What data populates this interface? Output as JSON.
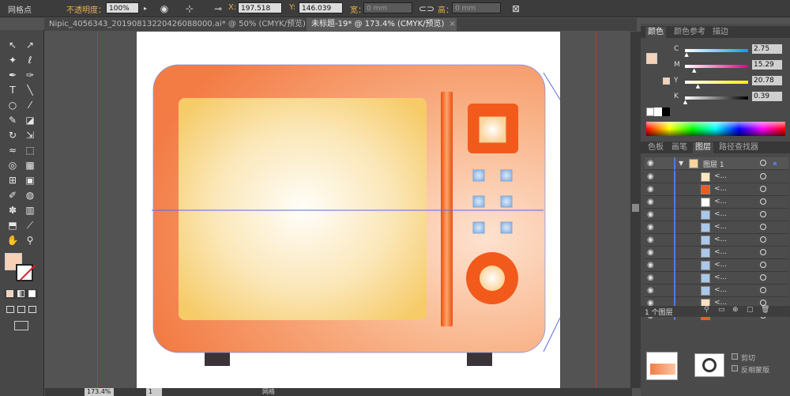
{
  "control_bar": {
    "tool_name": "网格点",
    "opacity_label": "不透明度：",
    "opacity_value": "100%",
    "x_label": "X:",
    "x_value": "197.518",
    "y_label": "Y:",
    "y_value": "146.039",
    "width_label": "宽：",
    "width_value": "0 mm",
    "height_label": "高：",
    "height_value": "0 mm"
  },
  "tabs": [
    {
      "label": "Nipic_4056343_20190813220426088000.ai* @ 50% (CMYK/预览)",
      "close": "×",
      "active": false
    },
    {
      "label": "未标题-19* @ 173.4% (CMYK/预览)",
      "close": "×",
      "active": true
    }
  ],
  "tools": [
    {
      "name": "selection-tool",
      "glyph": "↖"
    },
    {
      "name": "direct-selection-tool",
      "glyph": "↗"
    },
    {
      "name": "magic-wand-tool",
      "glyph": "✦"
    },
    {
      "name": "lasso-tool",
      "glyph": "ℓ"
    },
    {
      "name": "pen-tool",
      "glyph": "✒"
    },
    {
      "name": "curvature-tool",
      "glyph": "✑"
    },
    {
      "name": "type-tool",
      "glyph": "T"
    },
    {
      "name": "line-tool",
      "glyph": "╲"
    },
    {
      "name": "ellipse-tool",
      "glyph": "○"
    },
    {
      "name": "paintbrush-tool",
      "glyph": "⁄"
    },
    {
      "name": "pencil-tool",
      "glyph": "✎"
    },
    {
      "name": "eraser-tool",
      "glyph": "◪"
    },
    {
      "name": "rotate-tool",
      "glyph": "↻"
    },
    {
      "name": "scale-tool",
      "glyph": "⇲"
    },
    {
      "name": "warp-tool",
      "glyph": "≈"
    },
    {
      "name": "free-transform-tool",
      "glyph": "⬚"
    },
    {
      "name": "shape-builder-tool",
      "glyph": "◎"
    },
    {
      "name": "perspective-grid-tool",
      "glyph": "▦"
    },
    {
      "name": "mesh-tool",
      "glyph": "⊞"
    },
    {
      "name": "gradient-tool",
      "glyph": "▣"
    },
    {
      "name": "eyedropper-tool",
      "glyph": "✐"
    },
    {
      "name": "blend-tool",
      "glyph": "◍"
    },
    {
      "name": "symbol-sprayer-tool",
      "glyph": "✽"
    },
    {
      "name": "column-graph-tool",
      "glyph": "▥"
    },
    {
      "name": "artboard-tool",
      "glyph": "⬒"
    },
    {
      "name": "slice-tool",
      "glyph": "⟋"
    },
    {
      "name": "hand-tool",
      "glyph": "✋"
    },
    {
      "name": "zoom-tool",
      "glyph": "⚲"
    }
  ],
  "colors": {
    "fill_swatch": "#f7d1b5",
    "microwave_body_light": "#fbc6a4",
    "microwave_body_dark": "#f3844f",
    "accent": "#f25a1c",
    "window_center": "#fffdf8",
    "window_edge": "#f7cc69",
    "button_blue": "#9fc3e8",
    "feet": "#3a3338"
  },
  "color_panel": {
    "tabs": [
      "颜色",
      "颜色参考",
      "描边"
    ],
    "channels": [
      {
        "key": "C",
        "value": "2.75",
        "gradient": "linear-gradient(90deg,#fff,#00a0e6)",
        "pos": 0.03
      },
      {
        "key": "M",
        "value": "15.29",
        "gradient": "linear-gradient(90deg,#fff,#e6007e)",
        "pos": 0.15
      },
      {
        "key": "Y",
        "value": "20.78",
        "gradient": "linear-gradient(90deg,#fff,#fff000)",
        "pos": 0.21
      },
      {
        "key": "K",
        "value": "0.39",
        "gradient": "linear-gradient(90deg,#fff,#000)",
        "pos": 0.01
      }
    ]
  },
  "layers_panel": {
    "tabs": [
      "色板",
      "画笔",
      "图层",
      "路径查找器"
    ],
    "layer_name": "图层 1",
    "row_label": "<...",
    "sublayers": [
      "#fde8c0",
      "#f25a1c",
      "#ffffff",
      "#a9c8ec",
      "#a9c8ec",
      "#a9c8ec",
      "#a9c8ec",
      "#a9c8ec",
      "#a9c8ec",
      "#a9c8ec",
      "#fde0c0",
      "#f25a1c"
    ],
    "count_label": "1 个图层"
  },
  "bottom_panel": {
    "labels": [
      "剪切",
      "反相蒙版"
    ]
  },
  "status": {
    "zoom": "173.4%",
    "page": "1",
    "tool": "网格"
  }
}
